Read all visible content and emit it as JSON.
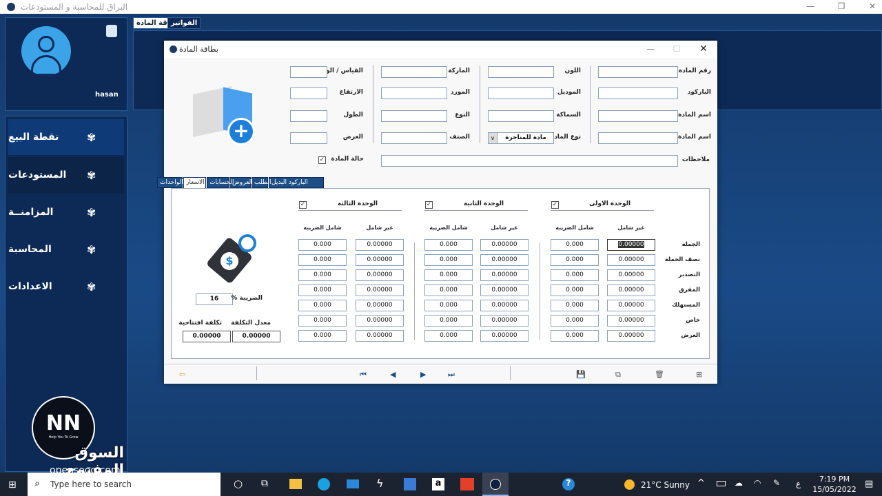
{
  "app": {
    "title": "البراق للمحاسبة و المستودعات",
    "minimize": "—",
    "maximize": "❐",
    "close": "✕"
  },
  "user": {
    "name": "hasan"
  },
  "sidebar": {
    "items": [
      {
        "label": "نقطة البيع"
      },
      {
        "label": "المستودعات"
      },
      {
        "label": "المزامنــة"
      },
      {
        "label": "المحاسبة"
      },
      {
        "label": "الاعدادات"
      }
    ]
  },
  "top_tabs": [
    {
      "label": "بطاقة المادة"
    },
    {
      "label": "الفواتير"
    }
  ],
  "dialog": {
    "title": "بطاقة المادة",
    "minimize": "—",
    "maximize": "☐",
    "close": "✕"
  },
  "form": {
    "col1": [
      {
        "label": "رقم المادة",
        "value": ""
      },
      {
        "label": "الباركود",
        "value": ""
      },
      {
        "label": "اسم المادة",
        "value": ""
      },
      {
        "label": "اسم المادة En",
        "value": ""
      }
    ],
    "col2": [
      {
        "label": "اللون",
        "value": ""
      },
      {
        "label": "الموديل",
        "value": ""
      },
      {
        "label": "السماكة",
        "value": ""
      },
      {
        "label": "نوع المادة",
        "value": "مادة للمتاجرة"
      }
    ],
    "col3": [
      {
        "label": "الماركة",
        "value": ""
      },
      {
        "label": "المورد",
        "value": ""
      },
      {
        "label": "النوع",
        "value": ""
      },
      {
        "label": "الصنف",
        "value": ""
      }
    ],
    "col4": [
      {
        "label": "القياس / الوزن",
        "value": ""
      },
      {
        "label": "الارتفاع",
        "value": ""
      },
      {
        "label": "الطول",
        "value": ""
      },
      {
        "label": "العرض",
        "value": ""
      }
    ],
    "notes_label": "ملاحظات",
    "notes_value": "",
    "status_label": "حالة المادة",
    "status_checked": true
  },
  "tabs": [
    {
      "label": "الباركود البديل"
    },
    {
      "label": "الطلب"
    },
    {
      "label": "العروض"
    },
    {
      "label": "الحسابات"
    },
    {
      "label": "الاسعار",
      "active": true
    },
    {
      "label": "الواحدات"
    }
  ],
  "prices": {
    "units": [
      {
        "label": "الوحدة الاولى",
        "checked": true
      },
      {
        "label": "الوحدة الثانية",
        "checked": true
      },
      {
        "label": "الوحدة الثالثة",
        "checked": true
      }
    ],
    "col_excl": "غير شامل",
    "col_incl": "شامل الضريبة",
    "rows": [
      {
        "label": "الجملة"
      },
      {
        "label": "نصف الجملة"
      },
      {
        "label": "التصدير"
      },
      {
        "label": "المفرق"
      },
      {
        "label": "المستهلك"
      },
      {
        "label": "خاص"
      },
      {
        "label": "العرض"
      }
    ],
    "excl_value": "0.00000",
    "incl_value": "0.000",
    "tax_label": "الضريبة %",
    "tax_value": "16",
    "avg_cost_label": "معدل التكلفة",
    "avg_cost_value": "0.00000",
    "open_cost_label": "تكلفة افتتاحية",
    "open_cost_value": "0.00000"
  },
  "toolbar": {
    "exit": "⇦",
    "first": "⏮",
    "prev": "◀",
    "next": "▶",
    "last": "⏭",
    "save": "💾",
    "copy": "⧉",
    "delete": "🗑",
    "new": "⊞"
  },
  "watermark": {
    "brand": "السوق المفتوح",
    "site": "opensooq.com",
    "slogan": "Help You To Grow"
  },
  "taskbar": {
    "search_placeholder": "Type here to search",
    "weather": "21°C  Sunny",
    "time": "7:19 PM",
    "date": "15/05/2022",
    "lang": "ع"
  }
}
